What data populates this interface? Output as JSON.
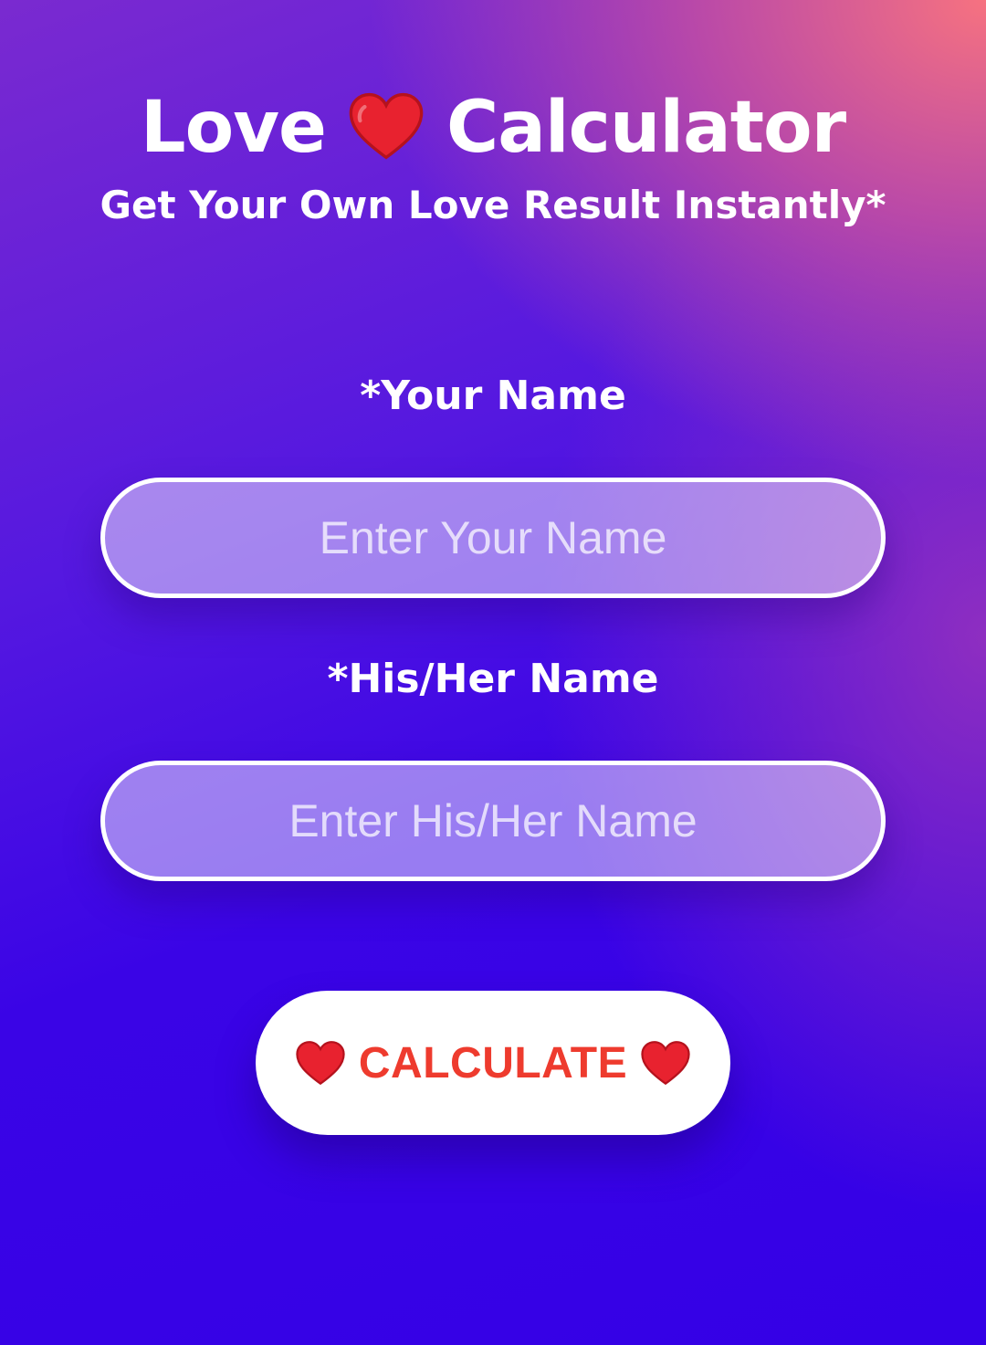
{
  "header": {
    "title_left": "Love",
    "title_right": "Calculator",
    "subtitle": "Get Your Own Love Result Instantly*",
    "title_icon": "heart-icon"
  },
  "form": {
    "your_name_label": "*Your Name",
    "your_name_placeholder": "Enter Your Name",
    "your_name_value": "",
    "partner_name_label": "*His/Her Name",
    "partner_name_placeholder": "Enter His/Her Name",
    "partner_name_value": ""
  },
  "button": {
    "label": "CALCULATE",
    "icon": "heart-icon"
  },
  "colors": {
    "heart": "#e8222f",
    "button_text": "#ee3b2e",
    "bg_top_right": "#f67280",
    "bg_bottom_left": "#3400e6"
  }
}
